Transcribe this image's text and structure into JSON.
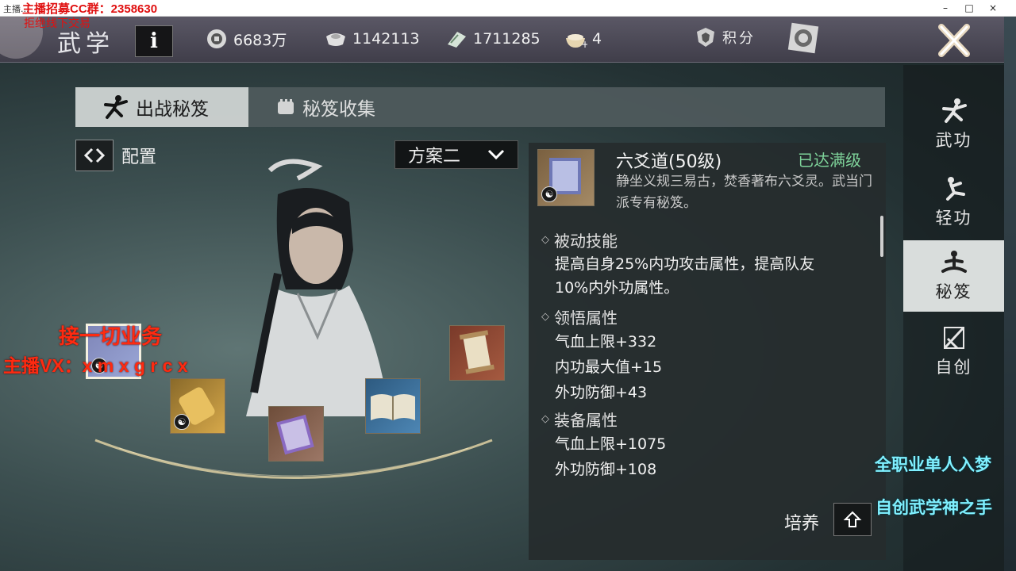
{
  "window": {
    "title": "主播...",
    "controls": {
      "minimize": "–",
      "maximize": "□",
      "close": "×"
    }
  },
  "stream": {
    "title": "主播招募CC群：2358630",
    "subtitle": "拒绝线下交易"
  },
  "topbar": {
    "title": "武学",
    "info_label": "i",
    "resources": [
      {
        "icon": "coin-icon",
        "value": "6683万"
      },
      {
        "icon": "silver-ingot-icon",
        "value": "1142113"
      },
      {
        "icon": "jade-icon",
        "value": "1711285"
      },
      {
        "icon": "bowl-plus-icon",
        "value": "4"
      }
    ],
    "score_label": "积分"
  },
  "tabs": [
    {
      "label": "出战秘笈",
      "icon": "martial-pose-icon",
      "active": true
    },
    {
      "label": "秘笈收集",
      "icon": "scroll-icon",
      "active": false
    }
  ],
  "config": {
    "label": "配置",
    "plan_selected": "方案二"
  },
  "book": {
    "name": "六爻道(50级)",
    "status": "已达满级",
    "description": "静坐义规三易古，焚香著布六爻灵。武当门派专有秘笈。"
  },
  "sections": [
    {
      "title": "被动技能",
      "lines": [
        "提高自身25%内功攻击属性，提高队友",
        "10%内外功属性。"
      ]
    },
    {
      "title": "领悟属性",
      "lines": [
        "气血上限+332",
        "内功最大值+15",
        "外功防御+43"
      ]
    },
    {
      "title": "装备属性",
      "lines": [
        "气血上限+1075",
        "外功防御+108"
      ]
    }
  ],
  "cultivate_label": "培养",
  "nav": [
    {
      "label": "武功",
      "icon": "martial-pose-icon",
      "active": false
    },
    {
      "label": "轻功",
      "icon": "lightness-kick-icon",
      "active": false
    },
    {
      "label": "秘笈",
      "icon": "meditation-icon",
      "active": true
    },
    {
      "label": "自创",
      "icon": "crossed-swords-icon",
      "active": false
    }
  ],
  "overlays": {
    "red_line1": "接一切业务",
    "red_line2": "主播VX：x m x g r c x",
    "cyan_line1": "全职业单人入梦",
    "cyan_line2": "自创武学神之手"
  },
  "colors": {
    "maxed": "#7ed39a",
    "overlay_red": "#ff2a10",
    "overlay_cyan": "#7ff0ff",
    "active_tab": "#cfd4d3"
  }
}
